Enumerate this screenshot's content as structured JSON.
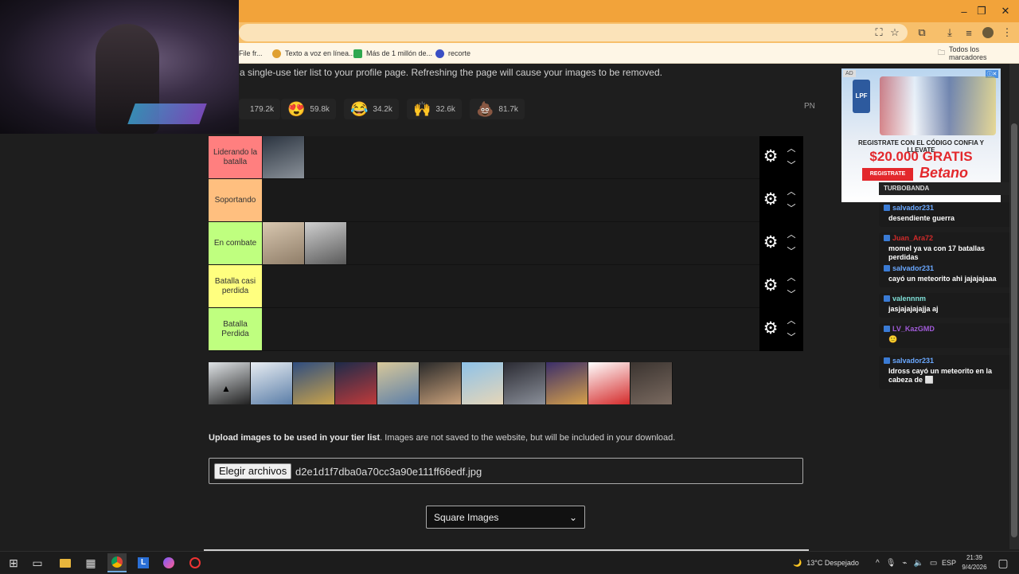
{
  "browser": {
    "window_controls": [
      "–",
      "❐",
      "✕"
    ],
    "bookmarks": [
      {
        "label": "File fr...",
        "color": "#555"
      },
      {
        "label": "Texto a voz en línea...",
        "color": "#e0a030"
      },
      {
        "label": "Más de 1 millón de...",
        "color": "#2fa84f"
      },
      {
        "label": "recorte",
        "color": "#3a4fc4"
      }
    ],
    "bookmarks_folder": "Todos los marcadores"
  },
  "page": {
    "intro": "a single-use tier list to your profile page. Refreshing the page will cause your images to be removed.",
    "reactions": [
      {
        "emoji": "",
        "count": "179.2k"
      },
      {
        "emoji": "😍",
        "count": "59.8k"
      },
      {
        "emoji": "😂",
        "count": "34.2k"
      },
      {
        "emoji": "🙌",
        "count": "32.6k"
      },
      {
        "emoji": "💩",
        "count": "81.7k"
      }
    ],
    "pn_label": "PN"
  },
  "tiers": [
    {
      "label": "Liderando la batalla",
      "color": "#ff7f7f",
      "items": [
        {
          "c1": "#2b3440",
          "c2": "#8a9199"
        }
      ]
    },
    {
      "label": "Soportando",
      "color": "#ffbf7f",
      "items": []
    },
    {
      "label": "En combate",
      "color": "#bfff7f",
      "items": [
        {
          "c1": "#d8c7b0",
          "c2": "#8f7d68"
        },
        {
          "c1": "#cfcfcf",
          "c2": "#5a5a5a"
        }
      ]
    },
    {
      "label": "Batalla casi perdida",
      "color": "#ffff7f",
      "items": []
    },
    {
      "label": "Batalla Perdida",
      "color": "#bfff7f",
      "items": []
    }
  ],
  "pool": [
    {
      "c1": "#dfe3e6",
      "c2": "#222"
    },
    {
      "c1": "#e8edf2",
      "c2": "#5b7ea8"
    },
    {
      "c1": "#2f4d80",
      "c2": "#c9a24a"
    },
    {
      "c1": "#1d2b4a",
      "c2": "#c03a3a"
    },
    {
      "c1": "#d8c89a",
      "c2": "#5b7ea8"
    },
    {
      "c1": "#2a2a2a",
      "c2": "#c8a07a"
    },
    {
      "c1": "#8ec2e8",
      "c2": "#e6d6b8"
    },
    {
      "c1": "#2b2b33",
      "c2": "#8a8f99"
    },
    {
      "c1": "#3b2e6a",
      "c2": "#d6a04a"
    },
    {
      "c1": "#ffffff",
      "c2": "#d42a2a"
    },
    {
      "c1": "#3b3430",
      "c2": "#7a6a60"
    }
  ],
  "upload": {
    "text_bold": "Upload images to be used in your tier list",
    "text_rest": ". Images are not saved to the website, but will be included in your download.",
    "button": "Elegir archivos",
    "file_name": "d2e1d1f7dba0a70cc3a90e111ff66edf.jpg"
  },
  "select": {
    "value": "Square Images"
  },
  "ad": {
    "badge": "AD",
    "logo": "LPF",
    "line1": "REGISTRATE CON EL CÓDIGO CONFIA Y LLEVATE",
    "line2": "$20.000 GRATIS",
    "cta": "REGISTRATE",
    "brand": "Betano"
  },
  "chat": {
    "turbo": "TURBOBANDA",
    "messages": [
      {
        "user": "salvador231",
        "color": "#6aa8ff",
        "text": "desendiente guerra"
      },
      {
        "user": "Juan_Ara72",
        "color": "#d02a2a",
        "text": "momel ya va con 17 batallas perdidas"
      },
      {
        "user": "salvador231",
        "color": "#6aa8ff",
        "text": "cayó un meteorito ahi jajajajaaa"
      },
      {
        "user": "valennnm",
        "color": "#7fe0d8",
        "text": "jasjajajajajja aj"
      },
      {
        "user": "LV_KazGMD",
        "color": "#a15bd9",
        "text": "🙂"
      },
      {
        "user": "salvador231",
        "color": "#6aa8ff",
        "text": "Idross cayó un meteorito en la cabeza de ⬜"
      }
    ]
  },
  "taskbar": {
    "weather": "13°C  Despejado",
    "lang": "ESP",
    "time": "21:39",
    "date": "9/4/2026"
  }
}
